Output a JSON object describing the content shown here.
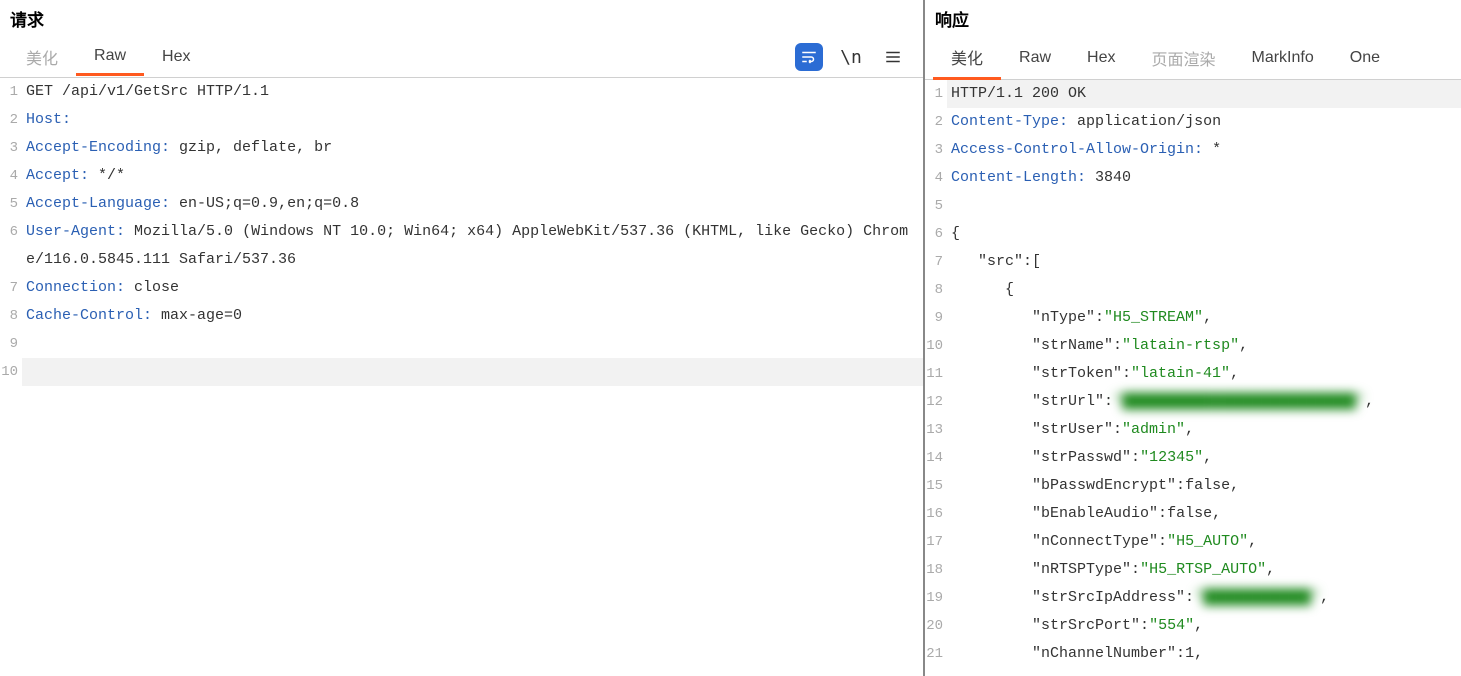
{
  "left": {
    "title": "请求",
    "tabs": {
      "beautify": "美化",
      "raw": "Raw",
      "hex": "Hex"
    },
    "active_tab": "raw",
    "actions": {
      "wrap": "wrap",
      "newline": "\\n",
      "menu": "menu"
    },
    "lines": [
      {
        "n": 1,
        "plain": "GET /api/v1/GetSrc HTTP/1.1"
      },
      {
        "n": 2,
        "key": "Host",
        "val": ""
      },
      {
        "n": 3,
        "key": "Accept-Encoding",
        "val": "gzip, deflate, br"
      },
      {
        "n": 4,
        "key": "Accept",
        "val": "*/*"
      },
      {
        "n": 5,
        "key": "Accept-Language",
        "val": "en-US;q=0.9,en;q=0.8"
      },
      {
        "n": 6,
        "key": "User-Agent",
        "val": "Mozilla/5.0 (Windows NT 10.0; Win64; x64) AppleWebKit/537.36 (KHTML, like Gecko) Chrome/116.0.5845.111 Safari/537.36"
      },
      {
        "n": 7,
        "key": "Connection",
        "val": "close"
      },
      {
        "n": 8,
        "key": "Cache-Control",
        "val": "max-age=0"
      },
      {
        "n": 9,
        "plain": ""
      },
      {
        "n": 10,
        "plain": "",
        "hl": true
      }
    ]
  },
  "right": {
    "title": "响应",
    "tabs": {
      "beautify": "美化",
      "raw": "Raw",
      "hex": "Hex",
      "pageRender": "页面渲染",
      "markinfo": "MarkInfo",
      "one": "One"
    },
    "active_tab": "beautify",
    "lines": [
      {
        "n": 1,
        "plain": "HTTP/1.1 200 OK",
        "hl": true
      },
      {
        "n": 2,
        "key": "Content-Type",
        "val": "application/json"
      },
      {
        "n": 3,
        "key": "Access-Control-Allow-Origin",
        "val": "*"
      },
      {
        "n": 4,
        "key": "Content-Length",
        "val": "3840"
      },
      {
        "n": 5,
        "plain": ""
      },
      {
        "n": 6,
        "json": {
          "indent": 0,
          "text": "{"
        }
      },
      {
        "n": 7,
        "json": {
          "indent": 1,
          "key": "src",
          "after": ":["
        }
      },
      {
        "n": 8,
        "json": {
          "indent": 2,
          "text": "{"
        }
      },
      {
        "n": 9,
        "json": {
          "indent": 3,
          "key": "nType",
          "str": "H5_STREAM",
          "comma": true
        }
      },
      {
        "n": 10,
        "json": {
          "indent": 3,
          "key": "strName",
          "str": "latain-rtsp",
          "comma": true
        }
      },
      {
        "n": 11,
        "json": {
          "indent": 3,
          "key": "strToken",
          "str": "latain-41",
          "comma": true
        }
      },
      {
        "n": 12,
        "json": {
          "indent": 3,
          "key": "strUrl",
          "str": "██████████████████████████",
          "comma": true,
          "blur": true
        }
      },
      {
        "n": 13,
        "json": {
          "indent": 3,
          "key": "strUser",
          "str": "admin",
          "comma": true
        }
      },
      {
        "n": 14,
        "json": {
          "indent": 3,
          "key": "strPasswd",
          "str": "12345",
          "comma": true
        }
      },
      {
        "n": 15,
        "json": {
          "indent": 3,
          "key": "bPasswdEncrypt",
          "lit": "false",
          "comma": true
        }
      },
      {
        "n": 16,
        "json": {
          "indent": 3,
          "key": "bEnableAudio",
          "lit": "false",
          "comma": true
        }
      },
      {
        "n": 17,
        "json": {
          "indent": 3,
          "key": "nConnectType",
          "str": "H5_AUTO",
          "comma": true
        }
      },
      {
        "n": 18,
        "json": {
          "indent": 3,
          "key": "nRTSPType",
          "str": "H5_RTSP_AUTO",
          "comma": true
        }
      },
      {
        "n": 19,
        "json": {
          "indent": 3,
          "key": "strSrcIpAddress",
          "str": "████████████",
          "comma": true,
          "blur": true
        }
      },
      {
        "n": 20,
        "json": {
          "indent": 3,
          "key": "strSrcPort",
          "str": "554",
          "comma": true
        }
      },
      {
        "n": 21,
        "json": {
          "indent": 3,
          "key": "nChannelNumber",
          "lit": "1",
          "comma": true
        }
      }
    ]
  }
}
